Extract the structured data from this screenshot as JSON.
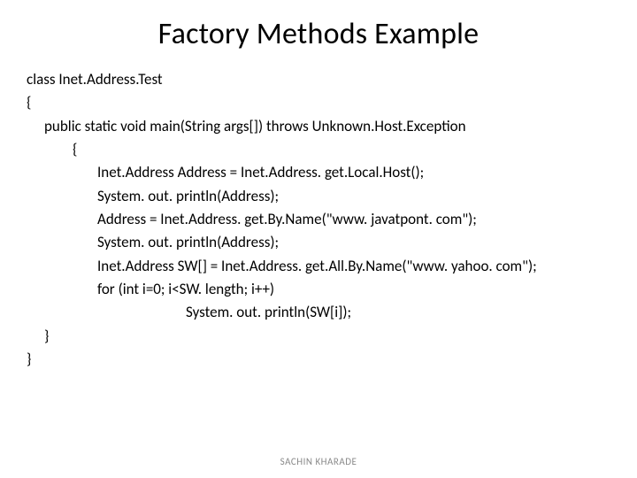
{
  "title": "Factory Methods Example",
  "code": {
    "l0": "class Inet.Address.Test",
    "l1": "{",
    "l2": "public static void main(String args[]) throws Unknown.Host.Exception",
    "l3": "{",
    "l4": "Inet.Address Address = Inet.Address. get.Local.Host();",
    "l5": "System. out. println(Address);",
    "l6": " Address = Inet.Address. get.By.Name(\"www. javatpont. com\");",
    "l7": "System. out. println(Address);",
    "l8": "Inet.Address SW[] = Inet.Address. get.All.By.Name(\"www. yahoo. com\");",
    "l9": "for (int i=0; i<SW. length; i++)",
    "l10": "System. out. println(SW[i]);",
    "l11": "}",
    "l12": "}"
  },
  "footer": "SACHIN KHARADE"
}
